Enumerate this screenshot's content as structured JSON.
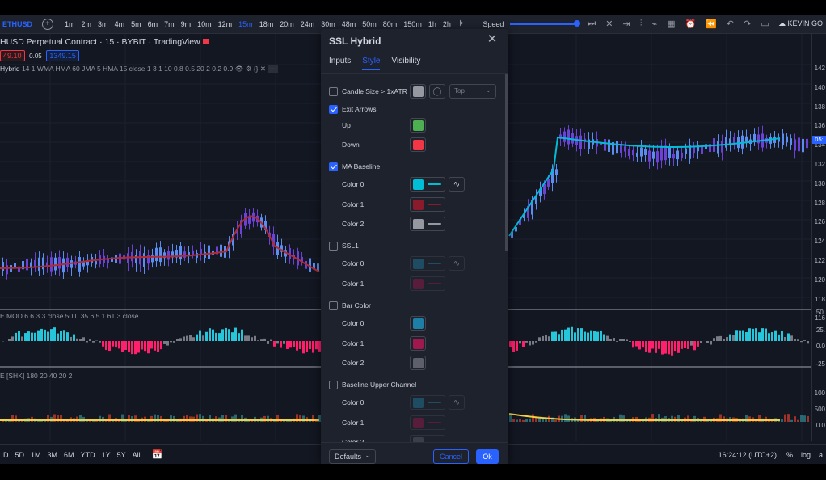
{
  "toolbar": {
    "symbol": "ETHUSD",
    "intervals": [
      "1m",
      "2m",
      "3m",
      "4m",
      "5m",
      "6m",
      "7m",
      "9m",
      "10m",
      "12m",
      "15m",
      "18m",
      "20m",
      "24m",
      "30m",
      "48m",
      "50m",
      "80m",
      "150m",
      "1h",
      "2h"
    ],
    "active_interval": "15m",
    "speed_label": "Speed",
    "user": "KEVIN GO"
  },
  "legend": {
    "title": "HUSD Perpetual Contract · 15 · BYBIT · TradingView",
    "price_red": "49.10",
    "change": "0.05",
    "price_blue": "1349.15",
    "indicator": "Hybrid",
    "indicator_params": "14 1 WMA HMA 60 JMA 5 HMA 15 close 1 3 1 10 0.8 0.5 20 2 0.2 0.9",
    "pane2": "E MOD 6 6 3 3 close 50 0.35 6 5 1.61 3 close",
    "pane3": "E [SHK] 180 20 40 20 2"
  },
  "y_axis": {
    "main": [
      "142",
      "140",
      "138",
      "136",
      "134",
      "132",
      "130",
      "128",
      "126",
      "124",
      "122",
      "120",
      "118",
      "116"
    ],
    "price_tag": "05:",
    "pane2": [
      "50.",
      "25.",
      "0.0",
      "-25"
    ],
    "pane3": [
      "100",
      "500",
      "0.0"
    ]
  },
  "x_axis": [
    "06:00",
    "12:00",
    "18:00",
    "16",
    "17",
    "06:00",
    "12:00",
    "18:00"
  ],
  "bottombar": {
    "ranges": [
      "D",
      "5D",
      "1M",
      "3M",
      "6M",
      "YTD",
      "1Y",
      "5Y",
      "All"
    ],
    "clock": "16:24:12 (UTC+2)",
    "pct": "%",
    "log": "log",
    "auto": "a"
  },
  "dialog": {
    "title": "SSL Hybrid",
    "tabs": [
      "Inputs",
      "Style",
      "Visibility"
    ],
    "active_tab": "Style",
    "rows": {
      "candle_size": "Candle Size > 1xATR",
      "candle_select": "Top",
      "exit_arrows": "Exit Arrows",
      "up": "Up",
      "down": "Down",
      "ma_baseline": "MA Baseline",
      "color0": "Color 0",
      "color1": "Color 1",
      "color2": "Color 2",
      "ssl1": "SSL1",
      "bar_color": "Bar Color",
      "baseline_upper": "Baseline Upper Channel"
    },
    "footer": {
      "defaults": "Defaults",
      "cancel": "Cancel",
      "ok": "Ok"
    }
  },
  "colors": {
    "accent": "#2962ff",
    "up": "#4caf50",
    "down": "#f23645",
    "baseline0": "#00bcd4",
    "baseline1": "#8b1a2b",
    "baseline2": "#9598a1",
    "ssl0": "#1e7fa6",
    "ssl1": "#a0184e",
    "bar0": "#1e7fa6",
    "bar1": "#a0184e",
    "bar2": "#5d606b",
    "chan0": "#1e7fa6",
    "chan1": "#a0184e"
  }
}
